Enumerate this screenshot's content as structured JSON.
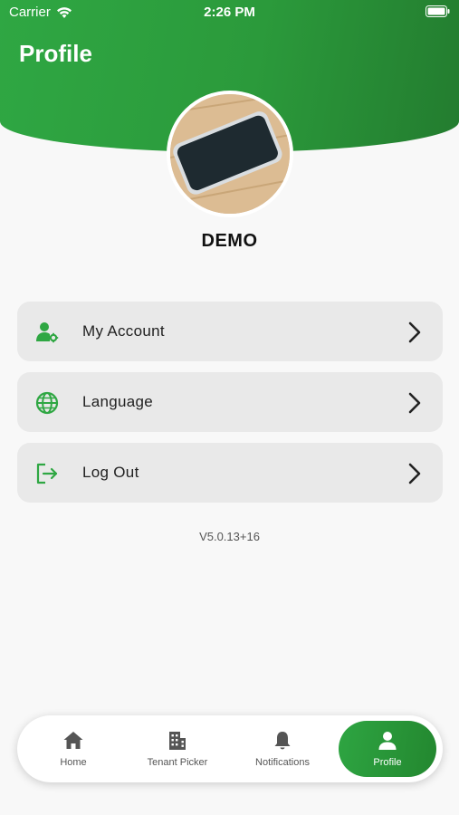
{
  "status_bar": {
    "carrier": "Carrier",
    "time": "2:26 PM"
  },
  "header": {
    "title": "Profile"
  },
  "profile": {
    "name": "DEMO"
  },
  "menu": {
    "items": [
      {
        "label": "My Account",
        "icon": "user-gear-icon"
      },
      {
        "label": "Language",
        "icon": "globe-icon"
      },
      {
        "label": "Log Out",
        "icon": "logout-icon"
      }
    ]
  },
  "version": "V5.0.13+16",
  "tabbar": {
    "tabs": [
      {
        "label": "Home",
        "icon": "home-icon"
      },
      {
        "label": "Tenant Picker",
        "icon": "building-icon"
      },
      {
        "label": "Notifications",
        "icon": "bell-icon"
      },
      {
        "label": "Profile",
        "icon": "person-icon",
        "active": true
      }
    ]
  },
  "colors": {
    "brand_green": "#2b9a3b",
    "icon_green": "#2fa743",
    "card_bg": "#e9e9e9",
    "background": "#f8f8f8"
  }
}
